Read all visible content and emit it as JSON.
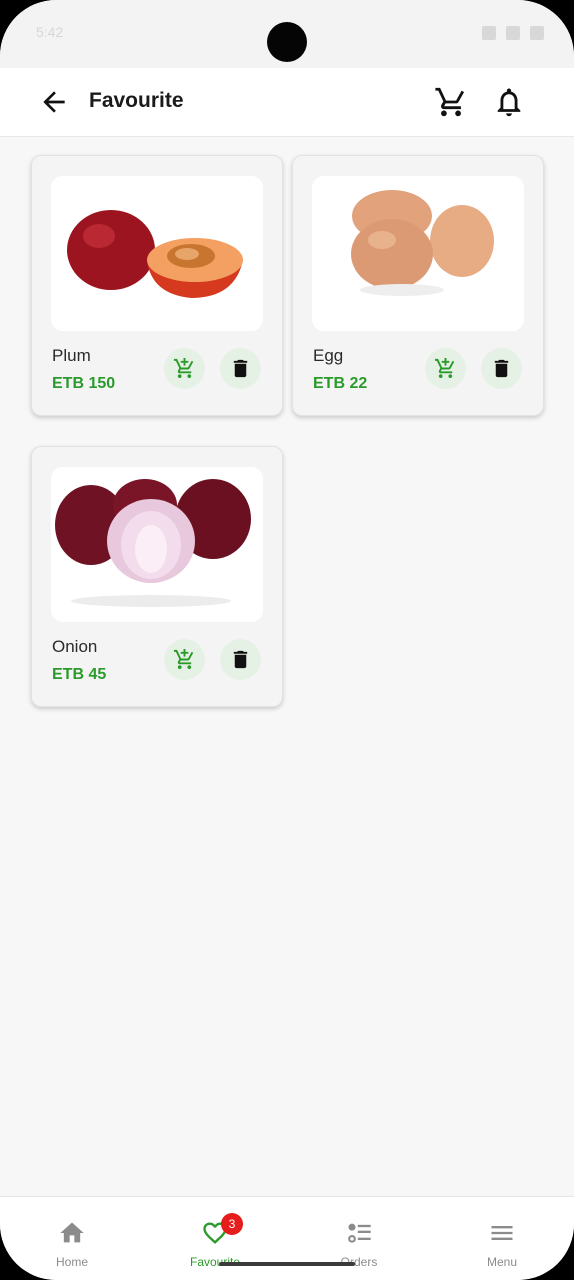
{
  "app": {
    "title": "Favourite"
  },
  "status": {
    "time": "5:42"
  },
  "favourites": [
    {
      "name": "Plum",
      "price": "ETB 150",
      "image": "plum"
    },
    {
      "name": "Egg",
      "price": "ETB 22",
      "image": "egg"
    },
    {
      "name": "Onion",
      "price": "ETB 45",
      "image": "onion"
    }
  ],
  "nav": {
    "items": [
      {
        "label": "Home",
        "icon": "home-icon"
      },
      {
        "label": "Favourite",
        "icon": "heart-icon",
        "badge": "3",
        "active": true
      },
      {
        "label": "Orders",
        "icon": "orders-icon"
      },
      {
        "label": "Menu",
        "icon": "menu-icon"
      }
    ]
  },
  "colors": {
    "accent": "#2a9b2a",
    "badge": "#e51d1d",
    "button_bg": "#e6f1e6"
  }
}
